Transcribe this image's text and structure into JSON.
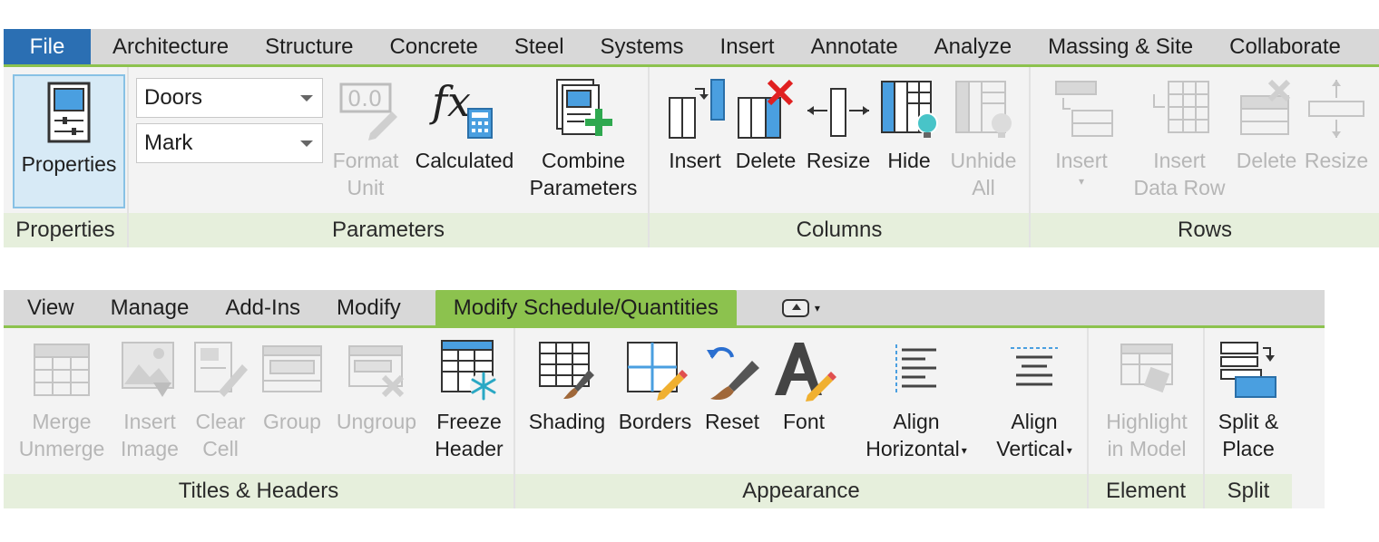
{
  "top": {
    "tabs": [
      "File",
      "Architecture",
      "Structure",
      "Concrete",
      "Steel",
      "Systems",
      "Insert",
      "Annotate",
      "Analyze",
      "Massing & Site",
      "Collaborate"
    ],
    "properties_panel": {
      "label": "Properties",
      "button": "Properties"
    },
    "parameters_panel": {
      "label": "Parameters",
      "category_select": "Doors",
      "parameter_select": "Mark",
      "format_unit": [
        "Format",
        "Unit"
      ],
      "calculated": "Calculated",
      "combine": [
        "Combine",
        "Parameters"
      ]
    },
    "columns_panel": {
      "label": "Columns",
      "insert": "Insert",
      "delete": "Delete",
      "resize": "Resize",
      "hide": "Hide",
      "unhide": [
        "Unhide",
        "All"
      ]
    },
    "rows_panel": {
      "label": "Rows",
      "insert": "Insert",
      "insert_data_row": [
        "Insert",
        "Data Row"
      ],
      "delete": "Delete",
      "resize": "Resize"
    }
  },
  "bottom": {
    "tabs": [
      "View",
      "Manage",
      "Add-Ins",
      "Modify",
      "Modify Schedule/Quantities"
    ],
    "titles_panel": {
      "label": "Titles & Headers",
      "merge": [
        "Merge",
        "Unmerge"
      ],
      "insert_image": [
        "Insert",
        "Image"
      ],
      "clear_cell": [
        "Clear",
        "Cell"
      ],
      "group": "Group",
      "ungroup": "Ungroup",
      "freeze": [
        "Freeze",
        "Header"
      ]
    },
    "appearance_panel": {
      "label": "Appearance",
      "shading": "Shading",
      "borders": "Borders",
      "reset": "Reset",
      "font": "Font",
      "align_h": [
        "Align",
        "Horizontal"
      ],
      "align_v": [
        "Align",
        "Vertical"
      ]
    },
    "element_panel": {
      "label": "Element",
      "highlight": [
        "Highlight",
        "in Model"
      ]
    },
    "split_panel": {
      "label": "Split",
      "split_place": [
        "Split &",
        "Place"
      ]
    }
  },
  "colors": {
    "file_tab": "#2b6fb3",
    "active_tab": "#8cc24e",
    "panel_label": "#e6efdc",
    "accent_blue": "#4a9fe0",
    "accent_green": "#2ea84f",
    "accent_red": "#e02020"
  }
}
